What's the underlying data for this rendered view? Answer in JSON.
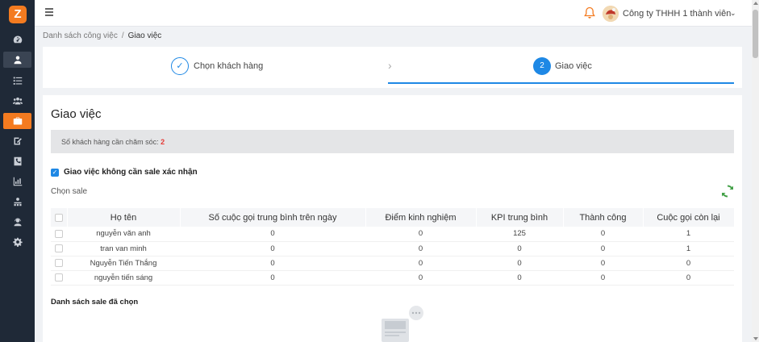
{
  "sidebar": {
    "logo": "Z",
    "items": [
      {
        "icon": "dashboard-icon"
      },
      {
        "icon": "user-icon"
      },
      {
        "icon": "list-icon"
      },
      {
        "icon": "users-icon"
      },
      {
        "icon": "briefcase-icon"
      },
      {
        "icon": "edit-icon"
      },
      {
        "icon": "phone-icon"
      },
      {
        "icon": "chart-icon"
      },
      {
        "icon": "team-icon"
      },
      {
        "icon": "support-icon"
      },
      {
        "icon": "settings-icon"
      }
    ]
  },
  "header": {
    "menu_icon": "hamburger-icon",
    "company_name": "Công ty THHH 1 thành viên",
    "caret": "⌄"
  },
  "breadcrumb": {
    "parent": "Danh sách công việc",
    "separator": "/",
    "current": "Giao việc"
  },
  "steps": [
    {
      "marker": "✓",
      "label": "Chọn khách hàng",
      "state": "done"
    },
    {
      "marker": "2",
      "label": "Giao việc",
      "state": "active"
    }
  ],
  "step_arrow": "›",
  "card": {
    "title": "Giao việc",
    "info_label": "Số khách hàng cần chăm sóc: ",
    "info_count": "2",
    "checkbox_mark": "✓",
    "checkbox_label": "Giao việc không cần sale xác nhận",
    "choose_sale_label": "Chọn sale",
    "selected_title": "Danh sách sale đã chọn"
  },
  "table": {
    "headers": [
      "Họ tên",
      "Số cuộc gọi trung bình trên ngày",
      "Điểm kinh nghiệm",
      "KPI trung bình",
      "Thành công",
      "Cuộc gọi còn lại"
    ],
    "rows": [
      [
        "nguyễn văn anh",
        "0",
        "0",
        "125",
        "0",
        "1"
      ],
      [
        "tran van minh",
        "0",
        "0",
        "0",
        "0",
        "1"
      ],
      [
        "Nguyễn Tiến Thắng",
        "0",
        "0",
        "0",
        "0",
        "0"
      ],
      [
        "nguyễn tiến sáng",
        "0",
        "0",
        "0",
        "0",
        "0"
      ]
    ]
  },
  "colors": {
    "accent": "#f47b20",
    "primary": "#1e88e5",
    "sidebar": "#1f2937",
    "alert_red": "#e53935",
    "refresh_green": "#43a047"
  }
}
